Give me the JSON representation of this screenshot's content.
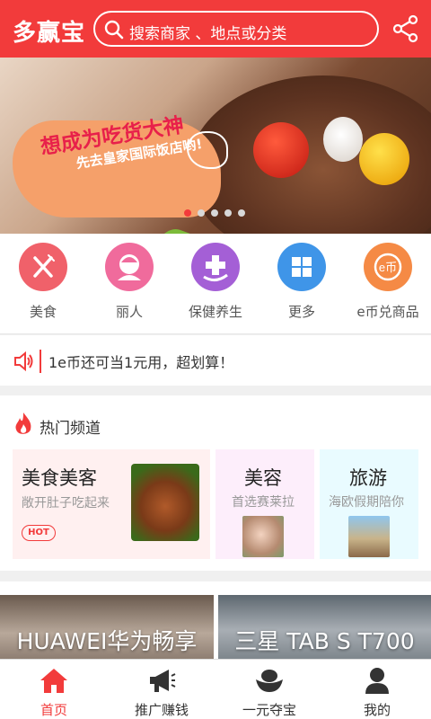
{
  "header": {
    "logo": "多赢宝",
    "search_placeholder": "搜索商家 、地点或分类",
    "search_icon": "search-icon",
    "share_icon": "share-icon"
  },
  "banner": {
    "title": "想成为吃货大神",
    "subtitle": "先去皇家国际饭店哟!",
    "page_count": 5,
    "active_page": 1
  },
  "categories": [
    {
      "label": "美食",
      "icon": "fork-knife-icon",
      "color": "#f0616a"
    },
    {
      "label": "丽人",
      "icon": "woman-icon",
      "color": "#f06b9c"
    },
    {
      "label": "保健养生",
      "icon": "health-plus-icon",
      "color": "#a45fd6"
    },
    {
      "label": "更多",
      "icon": "grid-icon",
      "color": "#3f95e8"
    },
    {
      "label": "e币兑商品",
      "icon": "e-coin-icon",
      "color": "#f58a45"
    }
  ],
  "notice": {
    "text": "1e币还可当1元用，超划算！",
    "icon": "speaker-icon"
  },
  "hot": {
    "title": "热门频道",
    "icon": "flame-icon",
    "cards": [
      {
        "title": "美食美客",
        "subtitle": "敞开肚子吃起来",
        "badge": "HOT"
      },
      {
        "title": "美容",
        "subtitle": "首选赛莱拉"
      },
      {
        "title": "旅游",
        "subtitle": "海欧假期陪你"
      }
    ]
  },
  "ads": [
    {
      "text": "HUAWEI华为畅享"
    },
    {
      "text": "三星 TAB S T700"
    }
  ],
  "nav": [
    {
      "label": "首页",
      "icon": "home-icon",
      "active": true
    },
    {
      "label": "推广赚钱",
      "icon": "megaphone-icon",
      "active": false
    },
    {
      "label": "一元夺宝",
      "icon": "treasure-icon",
      "active": false
    },
    {
      "label": "我的",
      "icon": "user-icon",
      "active": false
    }
  ],
  "colors": {
    "brand": "#f23b3b",
    "active_nav": "#f23b3b"
  }
}
